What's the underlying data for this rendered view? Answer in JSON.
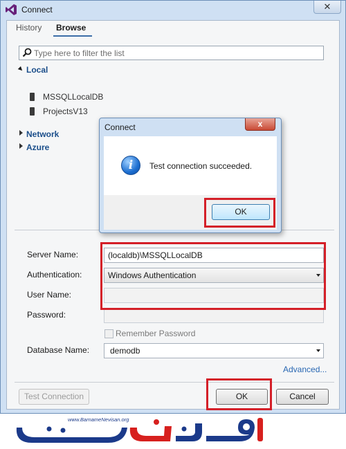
{
  "window": {
    "title": "Connect",
    "close_glyph": "✕"
  },
  "tabs": [
    {
      "label": "History",
      "active": false
    },
    {
      "label": "Browse",
      "active": true
    }
  ],
  "filter": {
    "placeholder": "Type here to filter the list",
    "icon": "search-icon"
  },
  "tree": {
    "local": {
      "label": "Local",
      "expanded": true
    },
    "servers": [
      {
        "label": "MSSQLLocalDB",
        "icon": "server-icon"
      },
      {
        "label": "ProjectsV13",
        "icon": "server-icon"
      }
    ],
    "network": {
      "label": "Network",
      "expanded": false
    },
    "azure": {
      "label": "Azure",
      "expanded": false
    }
  },
  "form": {
    "server_name_label": "Server Name:",
    "server_name_value": "(localdb)\\MSSQLLocalDB",
    "authentication_label": "Authentication:",
    "authentication_value": "Windows Authentication",
    "user_name_label": "User Name:",
    "user_name_value": "",
    "password_label": "Password:",
    "password_value": "",
    "remember_password_label": "Remember Password",
    "remember_password_checked": false,
    "database_name_label": "Database Name:",
    "database_name_value": "demodb",
    "advanced_link": "Advanced..."
  },
  "footer": {
    "test_connection_label": "Test Connection",
    "ok_label": "OK",
    "cancel_label": "Cancel"
  },
  "message_box": {
    "title": "Connect",
    "close_glyph": "x",
    "message": "Test connection succeeded.",
    "icon": "info-icon",
    "icon_glyph": "i",
    "ok_label": "OK"
  },
  "watermark": {
    "url": "www.BarnameNevisan.org",
    "logo_text": "برنامه نویسان"
  },
  "colors": {
    "highlight": "#d41f28",
    "window_frame": "#cfe0f3",
    "link": "#2867b2",
    "tree_label": "#1b4e8a",
    "logo_blue": "#1b3a8a",
    "logo_red": "#d7201e"
  }
}
